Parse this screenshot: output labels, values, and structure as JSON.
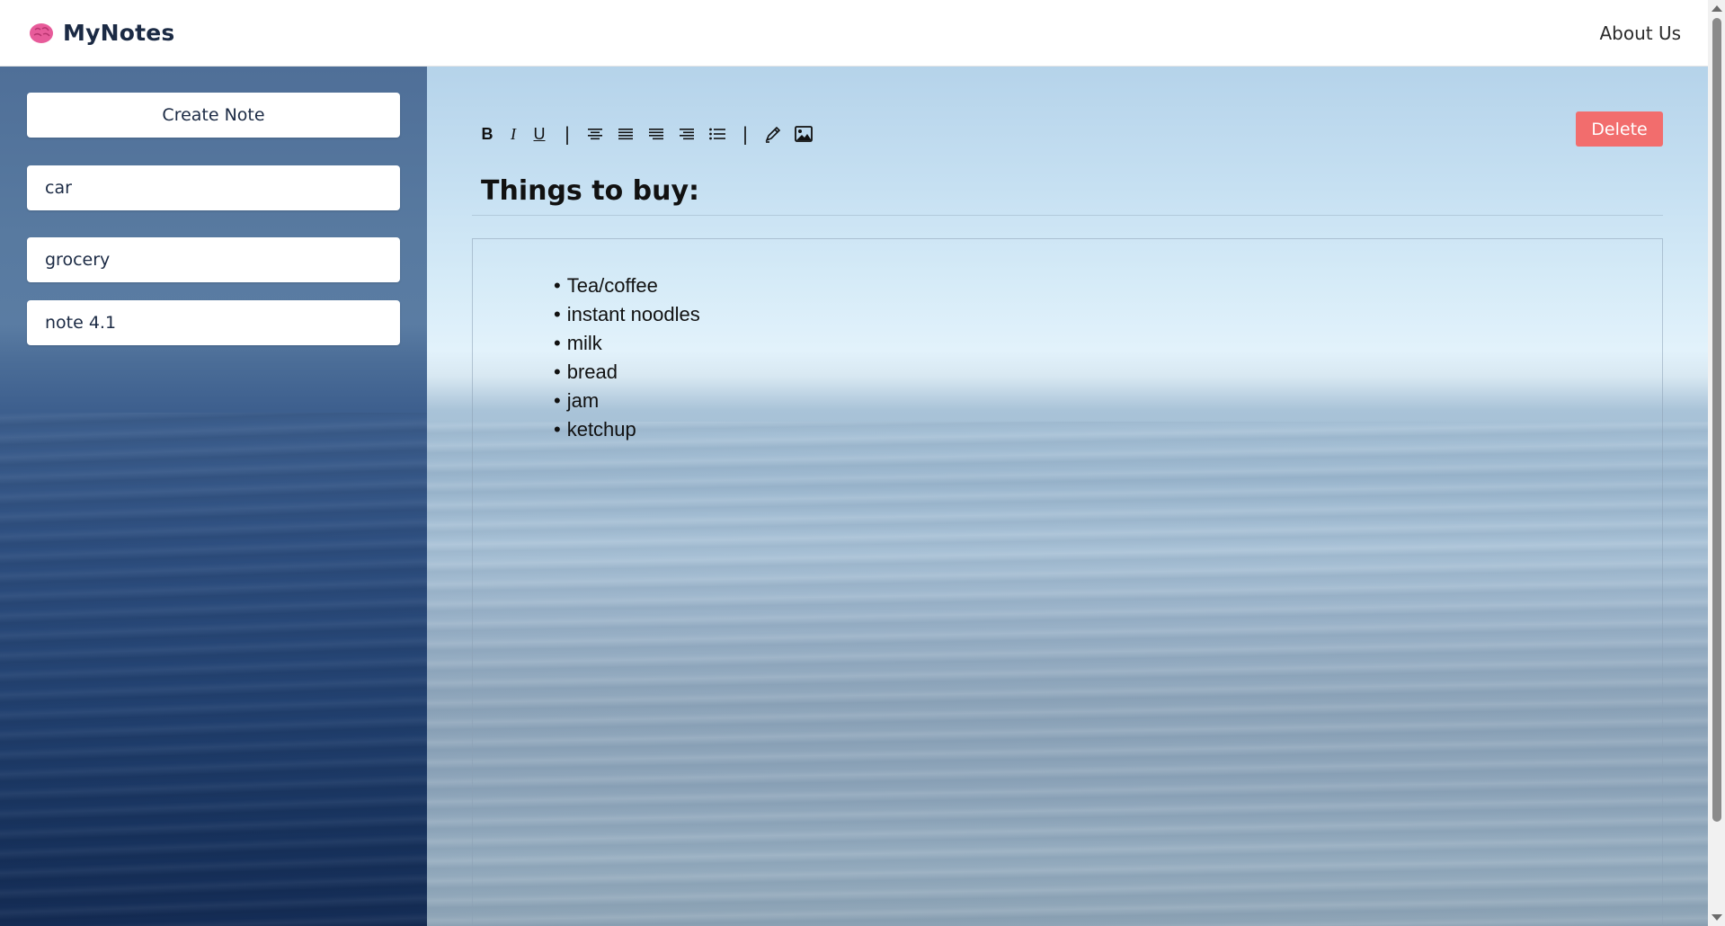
{
  "header": {
    "brand_name": "MyNotes",
    "brand_icon": "brain-icon",
    "about_label": "About Us"
  },
  "sidebar": {
    "create_label": "Create Note",
    "notes": [
      "car",
      "grocery",
      "note 4.1"
    ]
  },
  "toolbar": {
    "bold": "B",
    "italic": "I",
    "underline": "U",
    "separator": "|",
    "icons": [
      "align-center-icon",
      "align-left-icon",
      "align-justify-icon",
      "align-right-icon",
      "list-icon",
      "highlight-pen-icon",
      "image-icon"
    ]
  },
  "note": {
    "title": "Things to buy:",
    "items": [
      "Tea/coffee",
      "instant noodles",
      "milk",
      "bread",
      "jam",
      "ketchup"
    ],
    "delete_label": "Delete"
  },
  "colors": {
    "delete": "#f26d6d",
    "brand_text": "#1b2a44",
    "brain_icon": "#e75b9a"
  }
}
